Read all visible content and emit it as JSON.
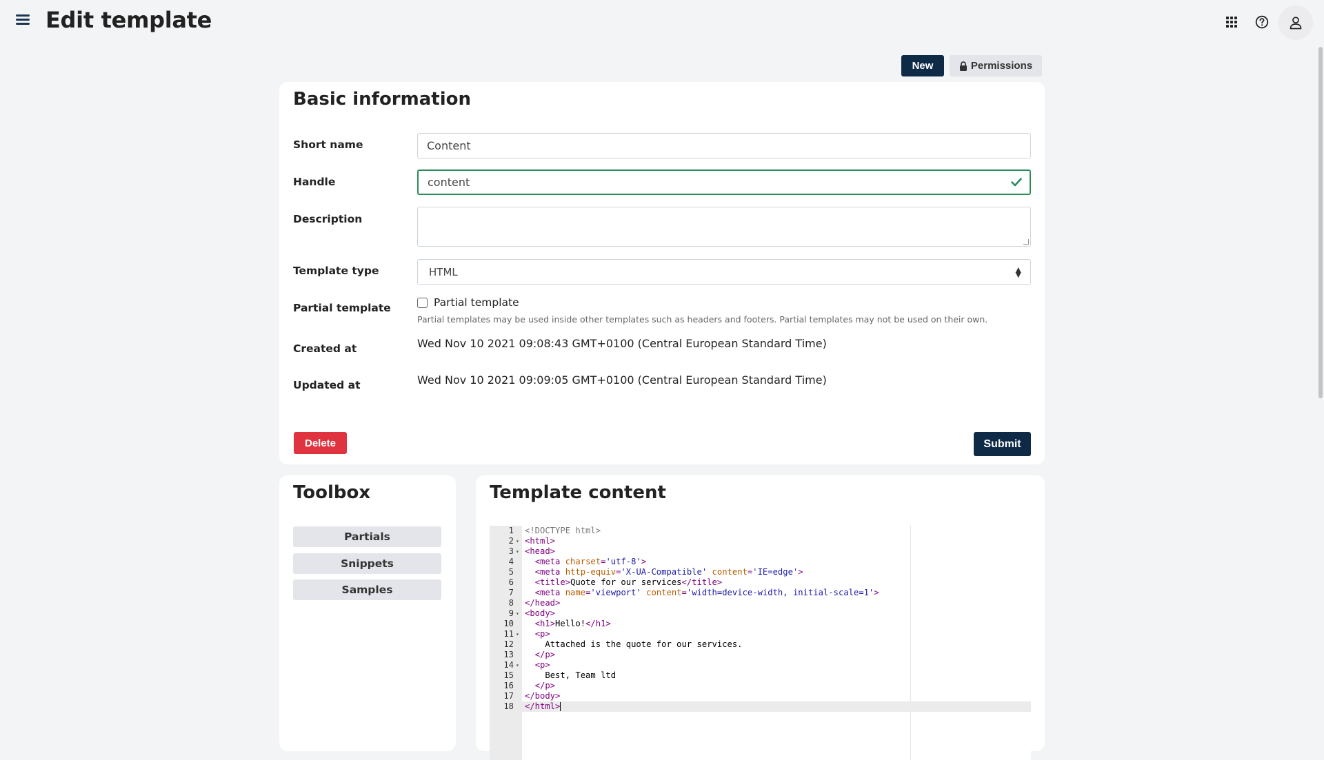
{
  "header": {
    "title": "Edit template",
    "icons": [
      "hamburger-menu-icon",
      "apps-grid-icon",
      "help-circle-icon",
      "user-icon"
    ]
  },
  "actions": {
    "new_label": "New",
    "permissions_label": "Permissions"
  },
  "basic_info": {
    "title": "Basic information",
    "short_name": {
      "label": "Short name",
      "value": "Content"
    },
    "handle": {
      "label": "Handle",
      "value": "content",
      "valid": true
    },
    "description": {
      "label": "Description",
      "value": ""
    },
    "template_type": {
      "label": "Template type",
      "value": "HTML"
    },
    "partial": {
      "label": "Partial template",
      "checkbox_label": "Partial template",
      "checked": false,
      "help": "Partial templates may be used inside other templates such as headers and footers. Partial templates may not be used on their own."
    },
    "created_at": {
      "label": "Created at",
      "value": "Wed Nov 10 2021 09:08:43 GMT+0100 (Central European Standard Time)"
    },
    "updated_at": {
      "label": "Updated at",
      "value": "Wed Nov 10 2021 09:09:05 GMT+0100 (Central European Standard Time)"
    },
    "delete_label": "Delete",
    "submit_label": "Submit"
  },
  "toolbox": {
    "title": "Toolbox",
    "items": [
      "Partials",
      "Snippets",
      "Samples"
    ]
  },
  "template_content": {
    "title": "Template content",
    "active_line": 18,
    "lines": [
      {
        "n": "1",
        "fold": false,
        "indent": "",
        "tokens": [
          [
            "doc",
            "<!DOCTYPE html>"
          ]
        ]
      },
      {
        "n": "2",
        "fold": true,
        "indent": "",
        "tokens": [
          [
            "tag",
            "<html>"
          ]
        ]
      },
      {
        "n": "3",
        "fold": true,
        "indent": "",
        "tokens": [
          [
            "tag",
            "<head>"
          ]
        ]
      },
      {
        "n": "4",
        "fold": false,
        "indent": "  ",
        "tokens": [
          [
            "tag",
            "<meta "
          ],
          [
            "attr",
            "charset"
          ],
          [
            "tag",
            "="
          ],
          [
            "str",
            "'utf-8'"
          ],
          [
            "tag",
            ">"
          ]
        ]
      },
      {
        "n": "5",
        "fold": false,
        "indent": "  ",
        "tokens": [
          [
            "tag",
            "<meta "
          ],
          [
            "attr",
            "http-equiv"
          ],
          [
            "tag",
            "="
          ],
          [
            "str",
            "'X-UA-Compatible'"
          ],
          [
            "tag",
            " "
          ],
          [
            "attr",
            "content"
          ],
          [
            "tag",
            "="
          ],
          [
            "str",
            "'IE=edge'"
          ],
          [
            "tag",
            ">"
          ]
        ]
      },
      {
        "n": "6",
        "fold": false,
        "indent": "  ",
        "tokens": [
          [
            "tag",
            "<title>"
          ],
          [
            "txt",
            "Quote for our services"
          ],
          [
            "tag",
            "</title>"
          ]
        ]
      },
      {
        "n": "7",
        "fold": false,
        "indent": "  ",
        "tokens": [
          [
            "tag",
            "<meta "
          ],
          [
            "attr",
            "name"
          ],
          [
            "tag",
            "="
          ],
          [
            "str",
            "'viewport'"
          ],
          [
            "tag",
            " "
          ],
          [
            "attr",
            "content"
          ],
          [
            "tag",
            "="
          ],
          [
            "str",
            "'width=device-width, initial-scale=1'"
          ],
          [
            "tag",
            ">"
          ]
        ]
      },
      {
        "n": "8",
        "fold": false,
        "indent": "",
        "tokens": [
          [
            "tag",
            "</head>"
          ]
        ]
      },
      {
        "n": "9",
        "fold": true,
        "indent": "",
        "tokens": [
          [
            "tag",
            "<body>"
          ]
        ]
      },
      {
        "n": "10",
        "fold": false,
        "indent": "  ",
        "tokens": [
          [
            "tag",
            "<h1>"
          ],
          [
            "txt",
            "Hello!"
          ],
          [
            "tag",
            "</h1>"
          ]
        ]
      },
      {
        "n": "11",
        "fold": true,
        "indent": "  ",
        "tokens": [
          [
            "tag",
            "<p>"
          ]
        ]
      },
      {
        "n": "12",
        "fold": false,
        "indent": "    ",
        "tokens": [
          [
            "txt",
            "Attached is the quote for our services."
          ]
        ]
      },
      {
        "n": "13",
        "fold": false,
        "indent": "  ",
        "tokens": [
          [
            "tag",
            "</p>"
          ]
        ]
      },
      {
        "n": "14",
        "fold": true,
        "indent": "  ",
        "tokens": [
          [
            "tag",
            "<p>"
          ]
        ]
      },
      {
        "n": "15",
        "fold": false,
        "indent": "    ",
        "tokens": [
          [
            "txt",
            "Best, Team ltd"
          ]
        ]
      },
      {
        "n": "16",
        "fold": false,
        "indent": "  ",
        "tokens": [
          [
            "tag",
            "</p>"
          ]
        ]
      },
      {
        "n": "17",
        "fold": false,
        "indent": "",
        "tokens": [
          [
            "tag",
            "</body>"
          ]
        ]
      },
      {
        "n": "18",
        "fold": false,
        "indent": "",
        "tokens": [
          [
            "tag",
            "</html>"
          ]
        ]
      }
    ]
  },
  "colors": {
    "primary": "#0e2a47",
    "danger": "#df3340",
    "valid": "#2a8c5a",
    "background": "#f3f4f6"
  }
}
